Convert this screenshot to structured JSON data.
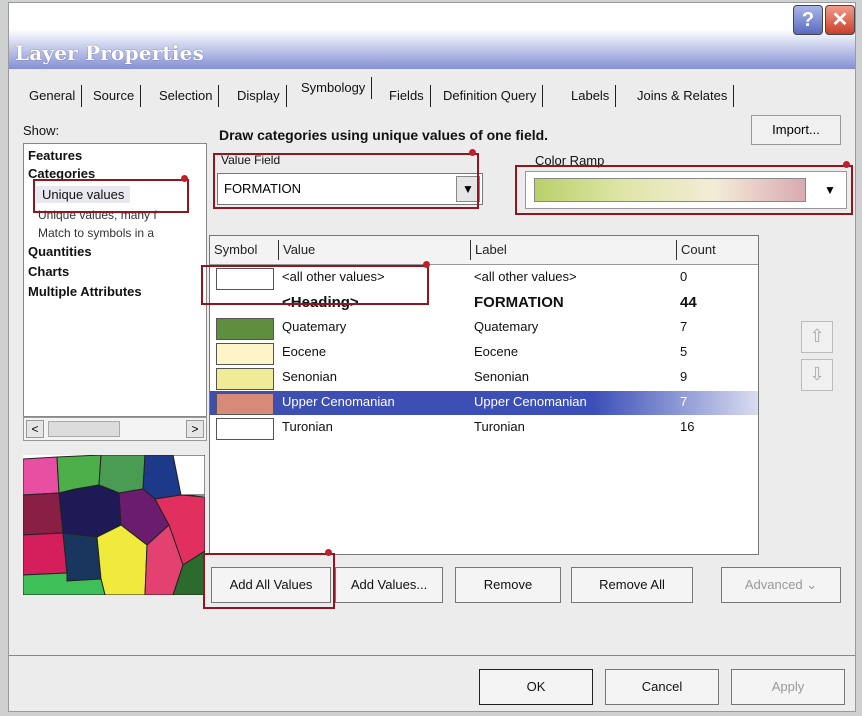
{
  "window": {
    "title": "Layer Properties",
    "help_glyph": "?",
    "close_glyph": "✕"
  },
  "tabs": [
    "General",
    "Source",
    "Selection",
    "Display",
    "Symbology",
    "Fields",
    "Definition Query",
    "Labels",
    "Joins & Relates"
  ],
  "active_tab": "Symbology",
  "show": {
    "label": "Show:",
    "items": [
      {
        "label": "Features"
      },
      {
        "label": "Categories"
      },
      {
        "label": "Unique values"
      },
      {
        "label": "Unique values, many f"
      },
      {
        "label": "Match to symbols in a"
      },
      {
        "label": "Quantities"
      },
      {
        "label": "Charts"
      },
      {
        "label": "Multiple Attributes"
      }
    ]
  },
  "description": "Draw categories using unique values of one field.",
  "import_label": "Import...",
  "value_field": {
    "label": "Value Field",
    "value": "FORMATION"
  },
  "color_ramp": {
    "label": "Color Ramp",
    "colors": [
      "#b9d06a",
      "#dfe6a8",
      "#f3ecd8",
      "#d9a9b1"
    ]
  },
  "table": {
    "headers": [
      "Symbol",
      "Value",
      "Label",
      "Count"
    ],
    "rows": [
      {
        "value": "<all other values>",
        "label": "<all other values>",
        "count": "0",
        "color": "#ffffff"
      },
      {
        "value": "<Heading>",
        "label": "FORMATION",
        "count": "44",
        "color": ""
      },
      {
        "value": "Quatemary",
        "label": "Quatemary",
        "count": "7",
        "color": "#5f8f3e"
      },
      {
        "value": "Eocene",
        "label": "Eocene",
        "count": "5",
        "color": "#fdf5c8"
      },
      {
        "value": "Senonian",
        "label": "Senonian",
        "count": "9",
        "color": "#f0eb96"
      },
      {
        "value": "Upper Cenomanian",
        "label": "Upper Cenomanian",
        "count": "7",
        "color": "#d78a77"
      },
      {
        "value": "Turonian",
        "label": "Turonian",
        "count": "16",
        "color": "#ffffff"
      }
    ]
  },
  "buttons": {
    "add_all": "Add All Values",
    "add": "Add Values...",
    "remove": "Remove",
    "remove_all": "Remove All",
    "advanced": "Advanced ⌄"
  },
  "footer": {
    "ok": "OK",
    "cancel": "Cancel",
    "apply": "Apply"
  },
  "icons": {
    "up": "⇧",
    "down": "⇩",
    "scroll_left": "<",
    "scroll_right": ">",
    "dropdown": "▼"
  }
}
